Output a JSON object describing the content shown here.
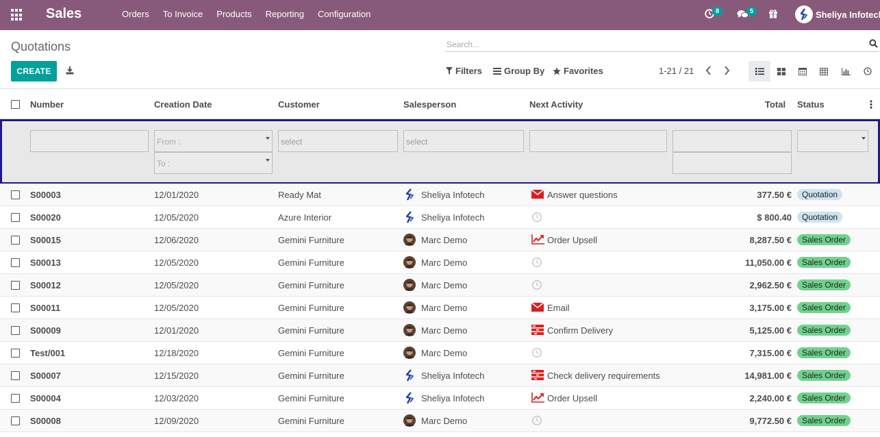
{
  "navbar": {
    "app_name": "Sales",
    "menu": [
      "Orders",
      "To Invoice",
      "Products",
      "Reporting",
      "Configuration"
    ],
    "activity_count": "8",
    "message_count": "5",
    "user": "Sheliya Infotech"
  },
  "control_panel": {
    "title": "Quotations",
    "search_placeholder": "Search...",
    "create_label": "CREATE",
    "filters_label": "Filters",
    "groupby_label": "Group By",
    "favorites_label": "Favorites",
    "pager": "1-21 / 21"
  },
  "columns": [
    "Number",
    "Creation Date",
    "Customer",
    "Salesperson",
    "Next Activity",
    "Total",
    "Status"
  ],
  "filter_row": {
    "date_from": "From :",
    "date_to": "To :",
    "customer_placeholder": "select",
    "salesperson_placeholder": "select"
  },
  "rows": [
    {
      "number": "S00003",
      "date": "12/01/2020",
      "customer": "Ready Mat",
      "salesperson": "Sheliya Infotech",
      "sp_type": "logo",
      "activity": "Answer questions",
      "activity_icon": "envelope-icon",
      "total": "377.50 €",
      "status": "Quotation"
    },
    {
      "number": "S00020",
      "date": "12/05/2020",
      "customer": "Azure Interior",
      "salesperson": "Sheliya Infotech",
      "sp_type": "logo",
      "activity": "",
      "activity_icon": "clock-icon",
      "total": "$ 800.40",
      "status": "Quotation"
    },
    {
      "number": "S00015",
      "date": "12/06/2020",
      "customer": "Gemini Furniture",
      "salesperson": "Marc Demo",
      "sp_type": "avatar",
      "activity": "Order Upsell",
      "activity_icon": "chart-line-icon",
      "total": "8,287.50 €",
      "status": "Sales Order"
    },
    {
      "number": "S00013",
      "date": "12/05/2020",
      "customer": "Gemini Furniture",
      "salesperson": "Marc Demo",
      "sp_type": "avatar",
      "activity": "",
      "activity_icon": "clock-icon",
      "total": "11,050.00 €",
      "status": "Sales Order"
    },
    {
      "number": "S00012",
      "date": "12/05/2020",
      "customer": "Gemini Furniture",
      "salesperson": "Marc Demo",
      "sp_type": "avatar",
      "activity": "",
      "activity_icon": "clock-icon",
      "total": "2,962.50 €",
      "status": "Sales Order"
    },
    {
      "number": "S00011",
      "date": "12/05/2020",
      "customer": "Gemini Furniture",
      "salesperson": "Marc Demo",
      "sp_type": "avatar",
      "activity": "Email",
      "activity_icon": "envelope-icon",
      "total": "3,175.00 €",
      "status": "Sales Order"
    },
    {
      "number": "S00009",
      "date": "12/01/2020",
      "customer": "Gemini Furniture",
      "salesperson": "Marc Demo",
      "sp_type": "avatar",
      "activity": "Confirm Delivery",
      "activity_icon": "tasks-icon",
      "total": "5,125.00 €",
      "status": "Sales Order"
    },
    {
      "number": "Test/001",
      "date": "12/18/2020",
      "customer": "Gemini Furniture",
      "salesperson": "Marc Demo",
      "sp_type": "avatar",
      "activity": "",
      "activity_icon": "clock-icon",
      "total": "7,315.00 €",
      "status": "Sales Order"
    },
    {
      "number": "S00007",
      "date": "12/15/2020",
      "customer": "Gemini Furniture",
      "salesperson": "Sheliya Infotech",
      "sp_type": "logo",
      "activity": "Check delivery requirements",
      "activity_icon": "tasks-icon",
      "total": "14,981.00 €",
      "status": "Sales Order"
    },
    {
      "number": "S00004",
      "date": "12/03/2020",
      "customer": "Gemini Furniture",
      "salesperson": "Sheliya Infotech",
      "sp_type": "logo",
      "activity": "Order Upsell",
      "activity_icon": "chart-line-icon",
      "total": "2,240.00 €",
      "status": "Sales Order"
    },
    {
      "number": "S00008",
      "date": "12/09/2020",
      "customer": "Gemini Furniture",
      "salesperson": "Marc Demo",
      "sp_type": "avatar",
      "activity": "",
      "activity_icon": "clock-icon",
      "total": "9,772.50 €",
      "status": "Sales Order"
    }
  ],
  "colors": {
    "navbar": "#875a7b",
    "primary": "#00a09d",
    "filter_border": "#1c1a8c",
    "quotation_badge": "#cde3f0",
    "sales_order_badge": "#6fd28c",
    "activity_red": "#dd1e1e"
  }
}
